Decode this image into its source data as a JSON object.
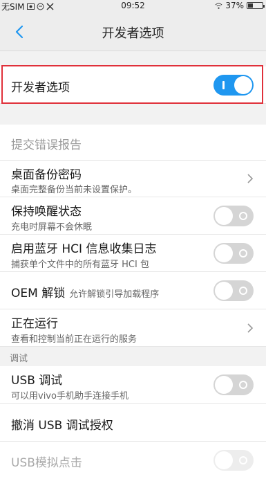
{
  "status_bar": {
    "carrier": "无SIM",
    "time": "09:52",
    "battery": "37%",
    "battery_level": 0.37
  },
  "header": {
    "title": "开发者选项"
  },
  "developer_toggle": {
    "label": "开发者选项",
    "state": "on"
  },
  "bug_report": {
    "label": "提交错误报告"
  },
  "backup_password": {
    "label": "桌面备份密码",
    "subtitle": "桌面完整备份当前未设置保护。"
  },
  "stay_awake": {
    "label": "保持唤醒状态",
    "subtitle": "充电时屏幕不会休眠",
    "state": "off"
  },
  "bt_hci": {
    "label": "启用蓝牙 HCI 信息收集日志",
    "subtitle": "捕获单个文件中的所有蓝牙 HCI 包",
    "state": "off"
  },
  "oem_unlock": {
    "label": "OEM 解锁",
    "subtitle": "允许解锁引导加载程序",
    "state": "off"
  },
  "running_services": {
    "label": "正在运行",
    "subtitle": "查看和控制当前正在运行的服务"
  },
  "debug_section": {
    "label": "调试"
  },
  "usb_debug": {
    "label": "USB 调试",
    "subtitle": "可以用vivo手机助手连接手机",
    "state": "off"
  },
  "revoke_usb": {
    "label": "撤消 USB 调试授权"
  },
  "usb_sim_click": {
    "label": "USB模拟点击",
    "state": "disabled"
  },
  "colors": {
    "accent": "#1f97f0",
    "highlight": "#e0303a"
  }
}
